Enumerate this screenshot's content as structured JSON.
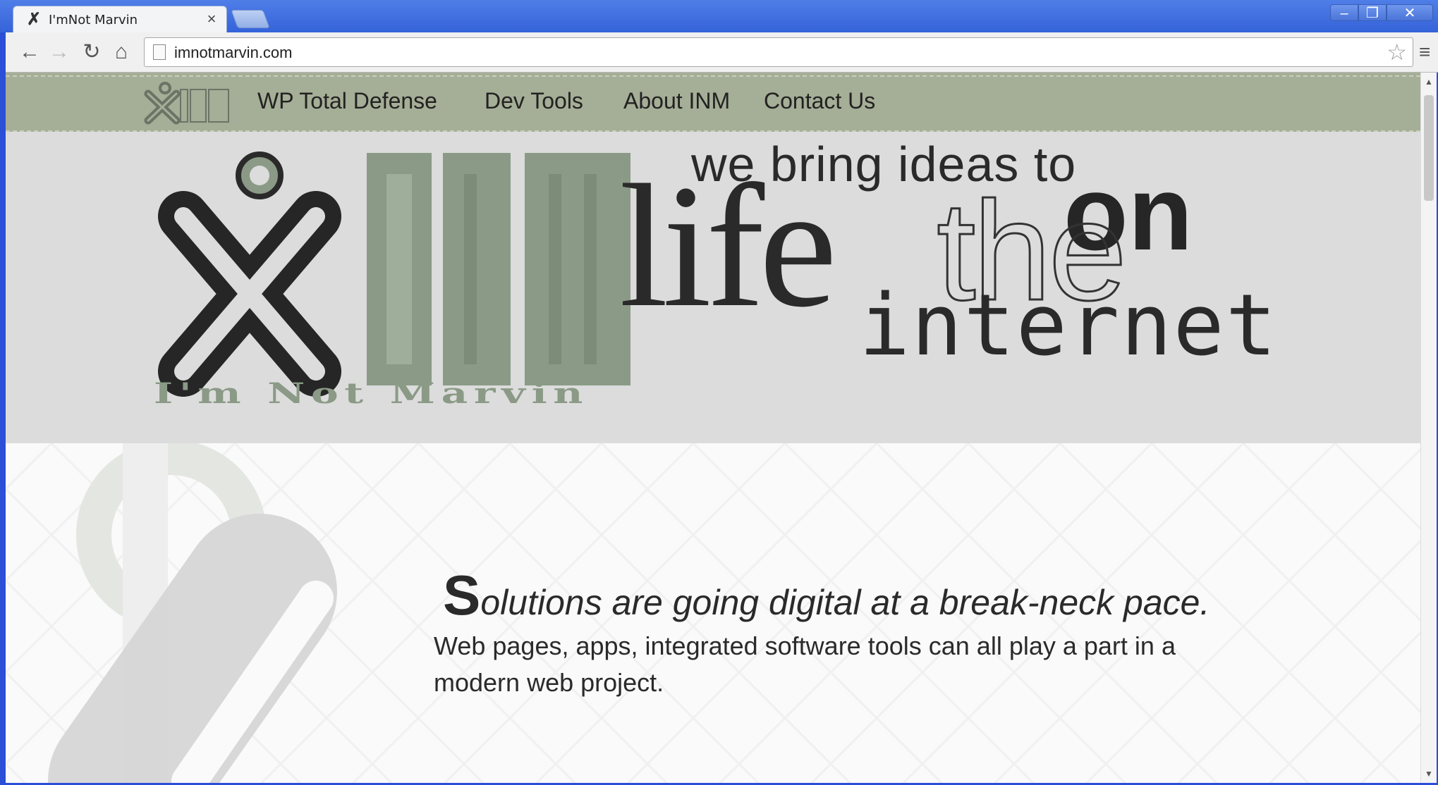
{
  "browser": {
    "tab_title": "I'mNot Marvin",
    "tab_close": "×",
    "url": "imnotmarvin.com",
    "window_buttons": {
      "min": "–",
      "max": "❐",
      "close": "✕"
    },
    "nav_icons": {
      "back": "back-arrow-icon",
      "forward": "forward-arrow-icon",
      "reload": "reload-icon",
      "home": "home-icon",
      "star": "bookmark-star-icon",
      "menu": "menu-icon"
    }
  },
  "site": {
    "nav_links": [
      "WP Total Defense",
      "Dev Tools",
      "About INM",
      "Contact Us"
    ],
    "hero": {
      "line1": "we bring ideas to",
      "life": "life",
      "the": "the",
      "on": "on",
      "internet": "internet",
      "brand": "I'm Not Marvin"
    },
    "intro": {
      "drop_cap": "S",
      "headline_rest": "olutions are going digital at a break-neck pace.",
      "body": " Web pages, apps, integrated software tools can all play a part in a modern web project."
    },
    "colors": {
      "nav_bg": "#a5ae96",
      "hero_bg": "#dcdcdc",
      "inm_green": "#8a9a86",
      "text": "#2a2a2a"
    }
  }
}
